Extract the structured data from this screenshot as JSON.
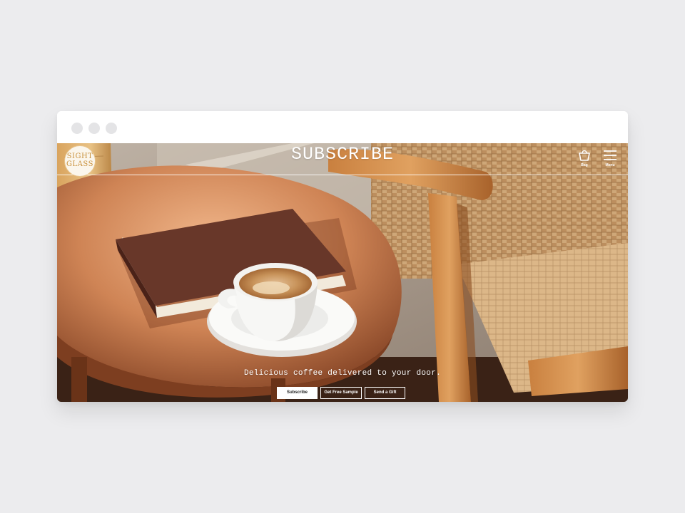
{
  "browser": {
    "controls": [
      "close",
      "minimize",
      "zoom"
    ]
  },
  "site": {
    "logo_lines": [
      "SIGHT",
      "GLASS"
    ],
    "page_title": "SUBSCRIBE",
    "nav": {
      "bag_label": "Bag",
      "bag_icon": "bag-icon",
      "menu_label": "Menu",
      "menu_icon": "hamburger-menu-icon"
    }
  },
  "hero": {
    "tagline": "Delicious coffee delivered to your door.",
    "buttons": {
      "subscribe": "Subscribe",
      "free_sample": "Get Free Sample",
      "gift": "Send a Gift"
    }
  },
  "colors": {
    "background": "#ececee",
    "window_chrome": "#ffffff",
    "chrome_dots": "#e4e4e6",
    "copper_table": "#c97a4a",
    "wicker": "#caa070",
    "cup": "#f8f8f6",
    "book": "#6e3a2c"
  }
}
